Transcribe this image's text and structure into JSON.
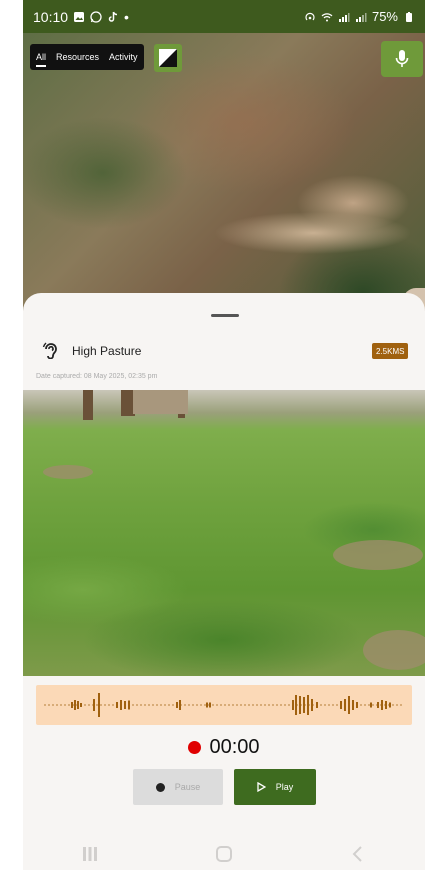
{
  "status_bar": {
    "time": "10:10",
    "battery": "75%"
  },
  "map": {
    "tabs": [
      {
        "label": "All",
        "active": true
      },
      {
        "label": "Resources",
        "active": false
      },
      {
        "label": "Activity",
        "active": false
      }
    ],
    "marker_label": "7"
  },
  "sheet": {
    "place_name": "High Pasture",
    "distance": "2.5KMS",
    "date_captured": "Date captured: 08 May 2025, 02:35 pm"
  },
  "audio": {
    "timer": "00:00",
    "pause_label": "Pause",
    "play_label": "Play"
  },
  "colors": {
    "status_bar": "#3e5a1e",
    "accent_green": "#6f9a3a",
    "play_green": "#3e6b1f",
    "distance_badge": "#a0610f",
    "waveform_bg": "#fbd9b7",
    "waveform_bars": "#a0610f",
    "record_red": "#e00000"
  },
  "icons": {
    "map_layer": "layer-toggle-icon",
    "mic": "microphone-icon",
    "place": "ear-sound-icon",
    "pause": "record-dot-icon",
    "play": "play-triangle-icon"
  }
}
